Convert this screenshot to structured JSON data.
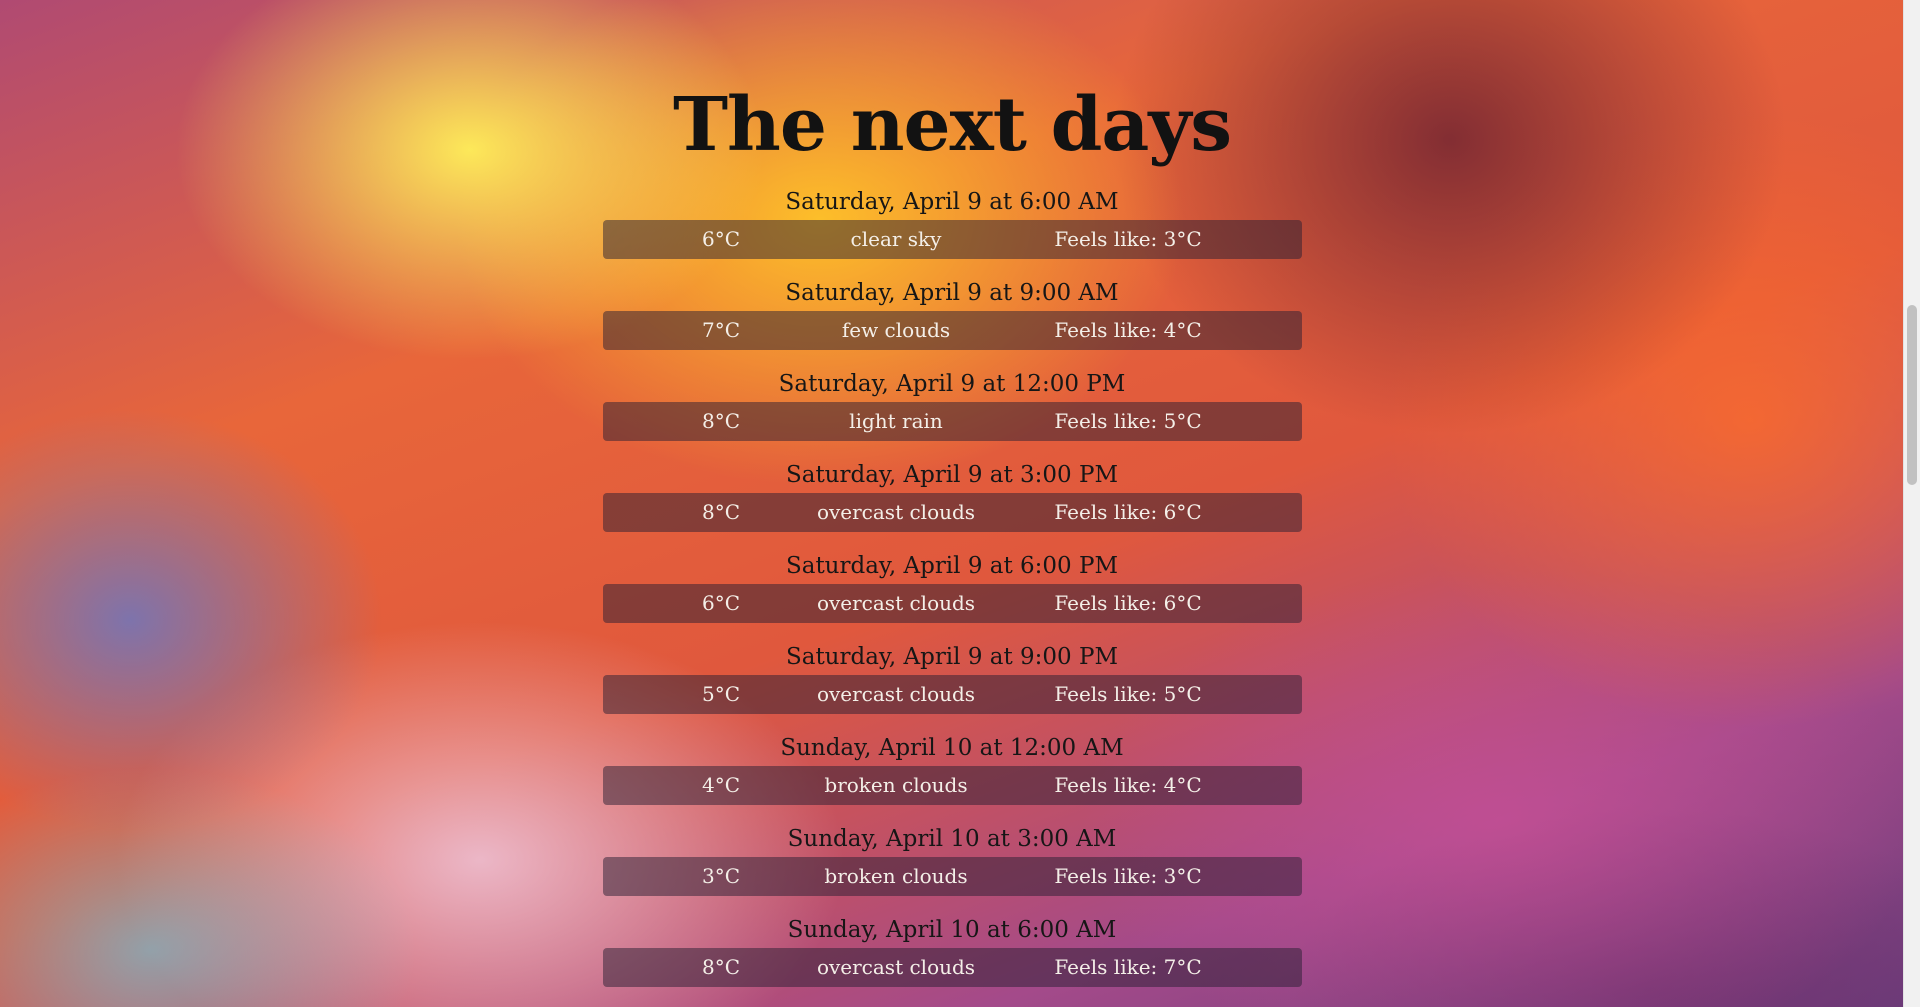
{
  "page": {
    "title": "The next days"
  },
  "forecasts": [
    {
      "datetime": "Saturday, April 9 at 6:00 AM",
      "temp": "6°C",
      "description": "clear sky",
      "feels_like": "Feels like: 3°C"
    },
    {
      "datetime": "Saturday, April 9 at 9:00 AM",
      "temp": "7°C",
      "description": "few clouds",
      "feels_like": "Feels like: 4°C"
    },
    {
      "datetime": "Saturday, April 9 at 12:00 PM",
      "temp": "8°C",
      "description": "light rain",
      "feels_like": "Feels like: 5°C"
    },
    {
      "datetime": "Saturday, April 9 at 3:00 PM",
      "temp": "8°C",
      "description": "overcast clouds",
      "feels_like": "Feels like: 6°C"
    },
    {
      "datetime": "Saturday, April 9 at 6:00 PM",
      "temp": "6°C",
      "description": "overcast clouds",
      "feels_like": "Feels like: 6°C"
    },
    {
      "datetime": "Saturday, April 9 at 9:00 PM",
      "temp": "5°C",
      "description": "overcast clouds",
      "feels_like": "Feels like: 5°C"
    },
    {
      "datetime": "Sunday, April 10 at 12:00 AM",
      "temp": "4°C",
      "description": "broken clouds",
      "feels_like": "Feels like: 4°C"
    },
    {
      "datetime": "Sunday, April 10 at 3:00 AM",
      "temp": "3°C",
      "description": "broken clouds",
      "feels_like": "Feels like: 3°C"
    },
    {
      "datetime": "Sunday, April 10 at 6:00 AM",
      "temp": "8°C",
      "description": "overcast clouds",
      "feels_like": "Feels like: 7°C"
    }
  ]
}
